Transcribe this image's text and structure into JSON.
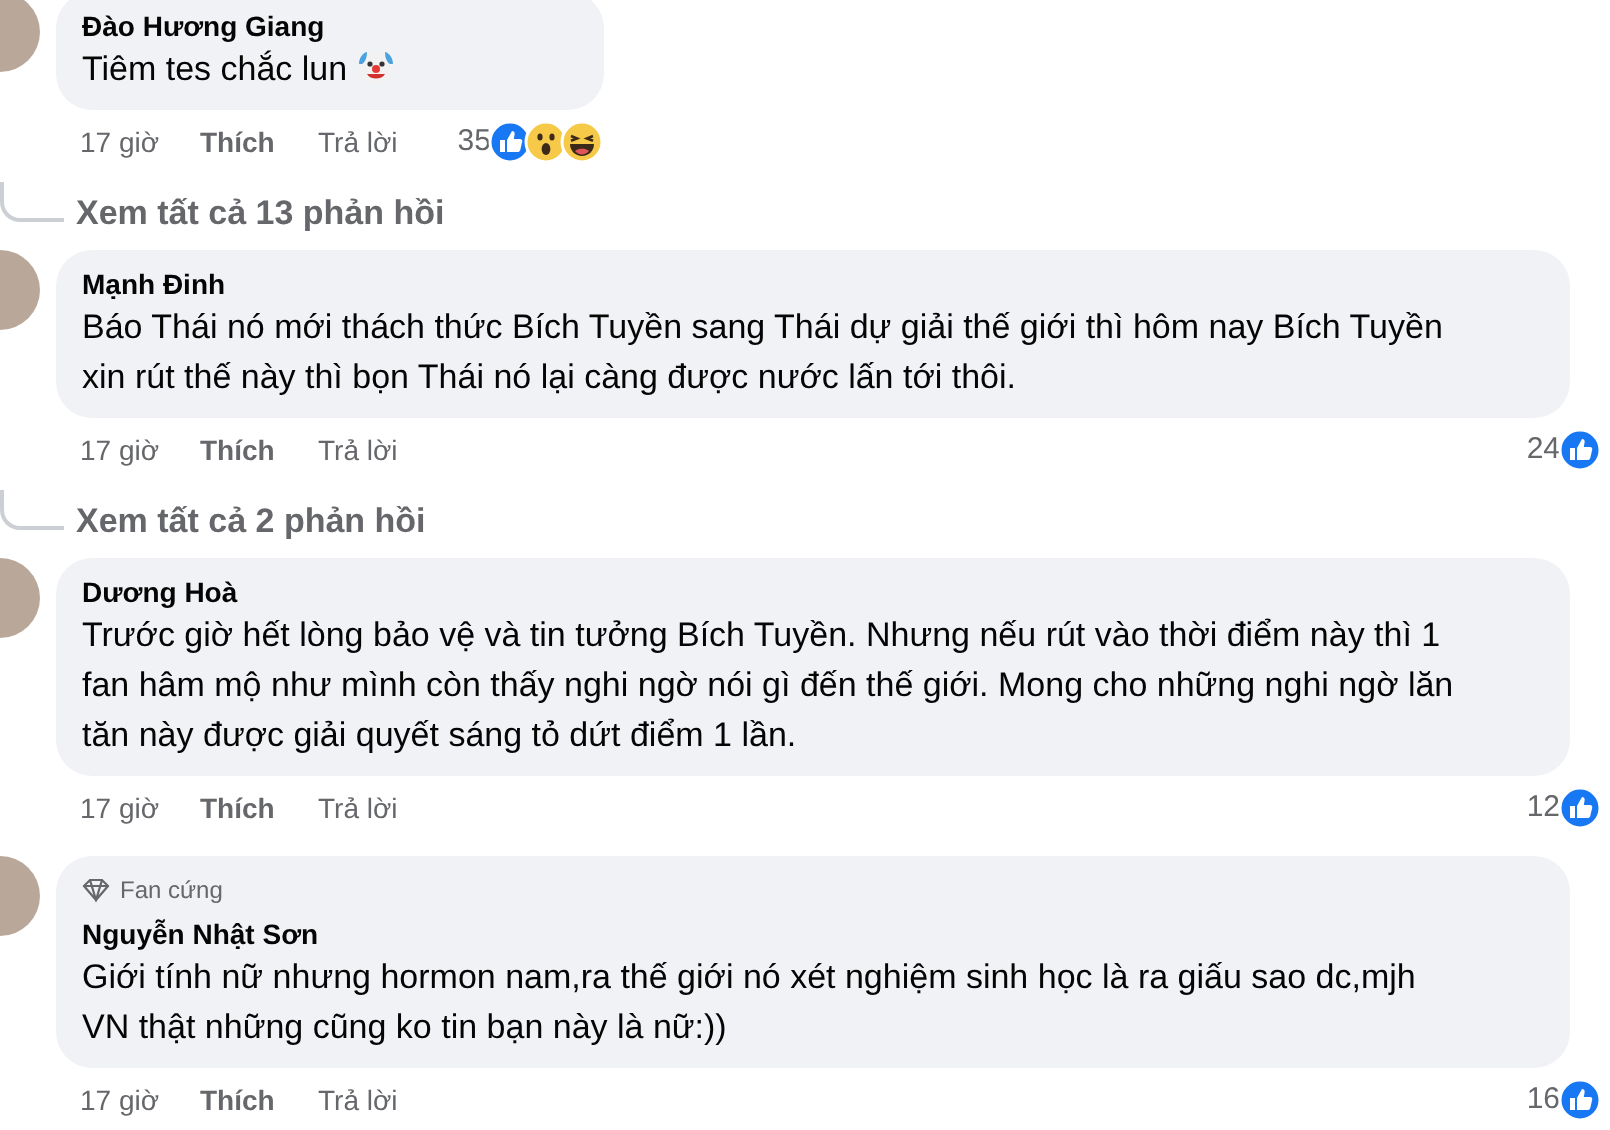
{
  "comments": [
    {
      "name": "Đào Hương Giang",
      "text": "Tiêm tes chắc lun",
      "emoji": {
        "kind": "clown"
      },
      "time": "17 giờ",
      "like": "Thích",
      "reply": "Trả lời",
      "count": "35",
      "reactions": [
        {
          "kind": "like"
        },
        {
          "kind": "wow"
        },
        {
          "kind": "haha"
        }
      ],
      "replies_link": "Xem tất cả 13 phản hồi"
    },
    {
      "name": "Mạnh Đinh",
      "text": "Báo Thái nó mới thách thức Bích Tuyền sang Thái dự giải thế giới thì hôm nay Bích Tuyền xin rút thế này thì bọn Thái nó lại càng được nước lấn tới thôi.",
      "time": "17 giờ",
      "like": "Thích",
      "reply": "Trả lời",
      "count": "24",
      "reactions": [
        {
          "kind": "like"
        }
      ],
      "replies_link": "Xem tất cả 2 phản hồi"
    },
    {
      "name": "Dương Hoà",
      "text": "Trước giờ hết lòng bảo vệ và tin tưởng Bích Tuyền. Nhưng nếu rút vào thời điểm này thì 1 fan hâm mộ như mình còn thấy nghi ngờ nói gì đến thế giới. Mong cho những nghi ngờ lăn tăn này được giải quyết sáng tỏ dứt điểm 1 lần.",
      "time": "17 giờ",
      "like": "Thích",
      "reply": "Trả lời",
      "count": "12",
      "reactions": [
        {
          "kind": "like"
        }
      ]
    },
    {
      "badge": "Fan cứng",
      "name": "Nguyễn Nhật Sơn",
      "text": "Giới tính nữ nhưng hormon nam,ra thế giới nó xét nghiệm sinh học là ra giấu sao dc,mjh VN thật những cũng ko tin bạn này là nữ:))",
      "time": "17 giờ",
      "like": "Thích",
      "reply": "Trả lời",
      "count": "16",
      "reactions": [
        {
          "kind": "like"
        }
      ]
    }
  ]
}
